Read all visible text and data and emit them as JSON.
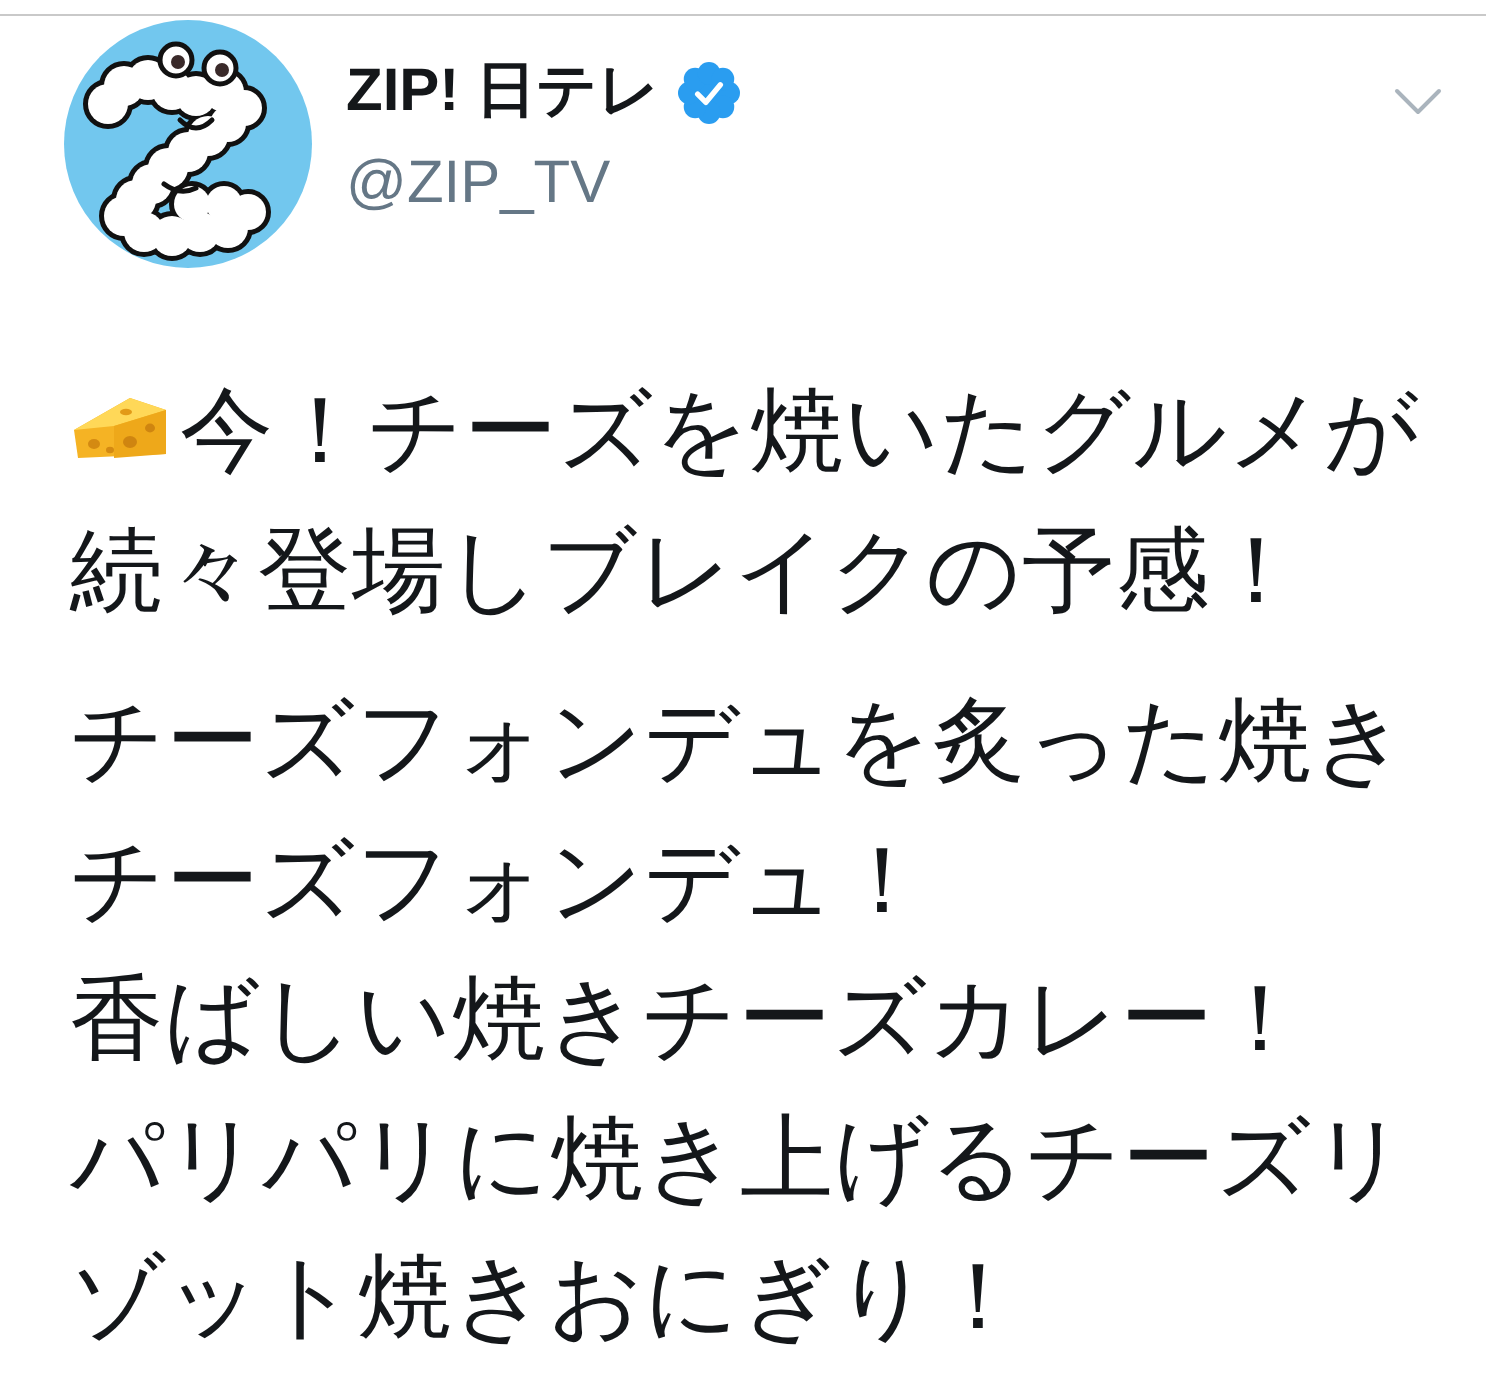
{
  "account": {
    "display_name": "ZIP! 日テレ",
    "verified": true,
    "handle": "@ZIP_TV"
  },
  "tweet": {
    "paragraphs": [
      [
        "今！チーズを焼いたグルメが",
        "続々登場しブレイクの予感！"
      ],
      [
        "チーズフォンデュを炙った焼きチーズフォンデュ！",
        "香ばしい焼きチーズカレー！",
        "パリパリに焼き上げるチーズリゾット焼きおにぎり！"
      ]
    ]
  }
}
